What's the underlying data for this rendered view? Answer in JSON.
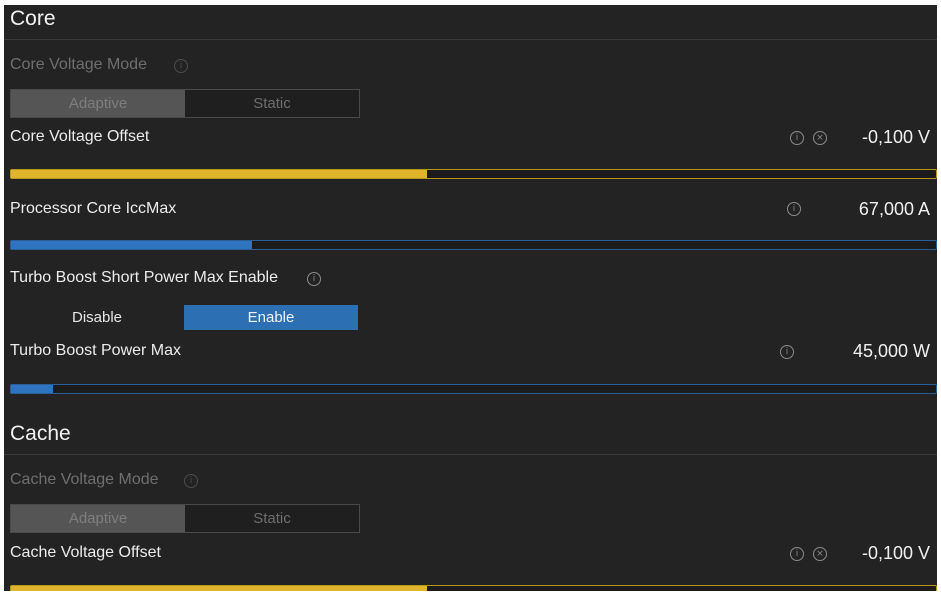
{
  "core": {
    "title": "Core",
    "voltage_mode": {
      "label": "Core Voltage Mode",
      "options": [
        "Adaptive",
        "Static"
      ],
      "selected": "Adaptive"
    },
    "voltage_offset": {
      "label": "Core Voltage Offset",
      "value": "-0,100 V",
      "slider_fraction": 0.45,
      "color": "#e0b52c"
    },
    "iccmax": {
      "label": "Processor Core IccMax",
      "value": "67,000 A",
      "slider_fraction": 0.26,
      "color": "#2f74c0"
    },
    "turbo_short_enable": {
      "label": "Turbo Boost Short Power Max Enable",
      "options": [
        "Disable",
        "Enable"
      ],
      "selected": "Enable"
    },
    "turbo_power_max": {
      "label": "Turbo Boost Power Max",
      "value": "45,000 W",
      "slider_fraction": 0.045,
      "color": "#2f74c0"
    }
  },
  "cache": {
    "title": "Cache",
    "voltage_mode": {
      "label": "Cache Voltage Mode",
      "options": [
        "Adaptive",
        "Static"
      ],
      "selected": "Adaptive"
    },
    "voltage_offset": {
      "label": "Cache Voltage Offset",
      "value": "-0,100 V",
      "slider_fraction": 0.45,
      "color": "#e0b52c"
    }
  },
  "icons": {
    "info": "info-circle-icon",
    "clear": "clear-circle-icon"
  }
}
